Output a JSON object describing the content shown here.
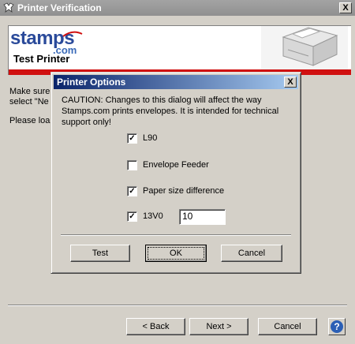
{
  "window": {
    "title": "Printer Verification",
    "close_label": "X"
  },
  "banner": {
    "logo_main": "stamps",
    "logo_sub": ".com",
    "heading": "Test Printer",
    "accent_color": "#d01010"
  },
  "background_text": {
    "line1": "Make sure",
    "line2": "select \"Ne",
    "line3": "Please loa"
  },
  "wizard_buttons": {
    "back": "< Back",
    "next": "Next >",
    "cancel": "Cancel",
    "help_icon": "?"
  },
  "dialog": {
    "title": "Printer Options",
    "close_label": "X",
    "caution": "CAUTION: Changes to this dialog will affect the way Stamps.com prints envelopes.  It is intended for technical support only!",
    "options": [
      {
        "label": "L90",
        "checked": true
      },
      {
        "label": "Envelope Feeder",
        "checked": false
      },
      {
        "label": "Paper size difference",
        "checked": true
      },
      {
        "label": "13V0",
        "checked": true
      }
    ],
    "offset_value": "10",
    "buttons": {
      "test": "Test",
      "ok": "OK",
      "cancel": "Cancel"
    }
  }
}
